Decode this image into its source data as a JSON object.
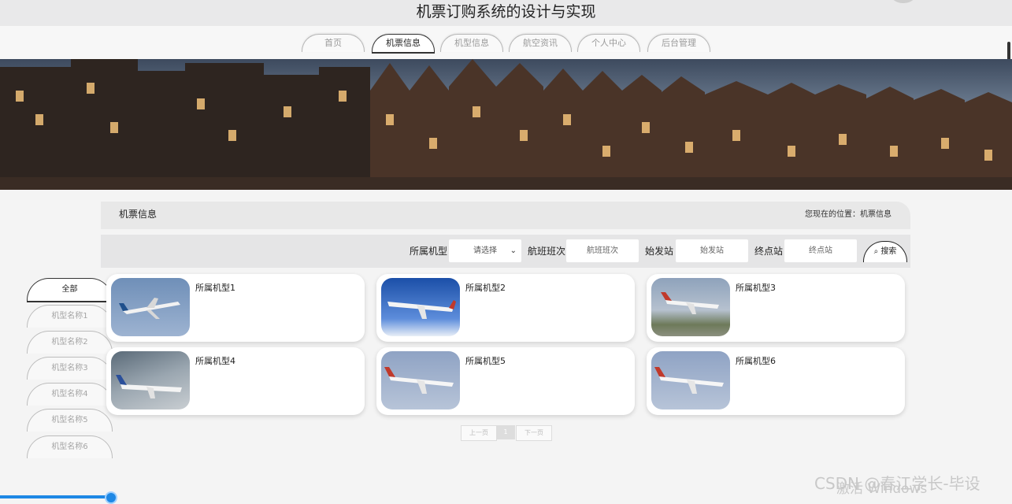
{
  "app": {
    "title": "机票订购系统的设计与实现"
  },
  "nav": [
    {
      "label": "首页",
      "active": false
    },
    {
      "label": "机票信息",
      "active": true
    },
    {
      "label": "机型信息",
      "active": false
    },
    {
      "label": "航空资讯",
      "active": false
    },
    {
      "label": "个人中心",
      "active": false
    },
    {
      "label": "后台管理",
      "active": false
    }
  ],
  "panel": {
    "title": "机票信息",
    "location": "您现在的位置：机票信息"
  },
  "filters": {
    "model_label": "所属机型",
    "model_value": "请选择",
    "flight_label": "航班班次",
    "flight_placeholder": "航班班次",
    "origin_label": "始发站",
    "origin_placeholder": "始发站",
    "dest_label": "终点站",
    "dest_placeholder": "终点站",
    "search_label": "搜索"
  },
  "categories": [
    {
      "label": "全部",
      "active": true
    },
    {
      "label": "机型名称1"
    },
    {
      "label": "机型名称2"
    },
    {
      "label": "机型名称3"
    },
    {
      "label": "机型名称4"
    },
    {
      "label": "机型名称5"
    },
    {
      "label": "机型名称6"
    }
  ],
  "cards": [
    {
      "label": "所属机型1"
    },
    {
      "label": "所属机型2"
    },
    {
      "label": "所属机型3"
    },
    {
      "label": "所属机型4"
    },
    {
      "label": "所属机型5"
    },
    {
      "label": "所属机型6"
    }
  ],
  "pager": {
    "prev": "上一页",
    "current": "1",
    "next": "下一页"
  },
  "watermark": {
    "activate": "激活 Windows",
    "csdn": "CSDN @春江学长-毕设"
  }
}
